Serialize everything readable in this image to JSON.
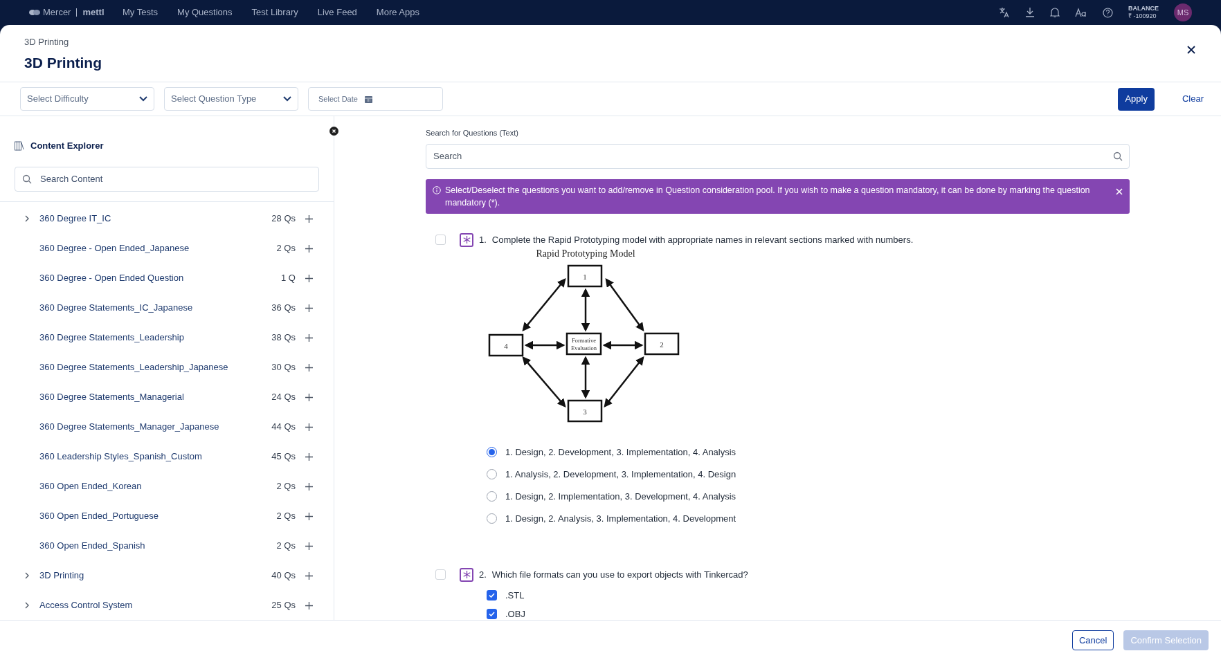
{
  "top_nav": {
    "logo": {
      "brand": "Mercer",
      "product": "mettl"
    },
    "items": [
      "My Tests",
      "My Questions",
      "Test Library",
      "Live Feed",
      "More Apps"
    ],
    "balance_label": "BALANCE",
    "balance_value": "₹ -100920",
    "avatar": "MS"
  },
  "modal": {
    "breadcrumb": "3D Printing",
    "title": "3D Printing"
  },
  "filters": {
    "difficulty": {
      "placeholder": "Select Difficulty"
    },
    "question_type": {
      "placeholder": "Select Question Type"
    },
    "date": {
      "placeholder": "Select Date"
    },
    "apply": "Apply",
    "clear": "Clear"
  },
  "sidebar": {
    "title": "Content Explorer",
    "search": {
      "placeholder": "Search Content"
    },
    "items": [
      {
        "label": "360 Degree IT_IC",
        "count": "28 Qs",
        "kind": "folder"
      },
      {
        "label": "360 Degree - Open Ended_Japanese",
        "count": "2 Qs",
        "kind": "leaf"
      },
      {
        "label": "360 Degree - Open Ended Question",
        "count": "1 Q",
        "kind": "leaf"
      },
      {
        "label": "360 Degree Statements_IC_Japanese",
        "count": "36 Qs",
        "kind": "leaf"
      },
      {
        "label": "360 Degree Statements_Leadership",
        "count": "38 Qs",
        "kind": "leaf"
      },
      {
        "label": "360 Degree Statements_Leadership_Japanese",
        "count": "30 Qs",
        "kind": "leaf"
      },
      {
        "label": "360 Degree Statements_Managerial",
        "count": "24 Qs",
        "kind": "leaf"
      },
      {
        "label": "360 Degree Statements_Manager_Japanese",
        "count": "44 Qs",
        "kind": "leaf"
      },
      {
        "label": "360 Leadership Styles_Spanish_Custom",
        "count": "45 Qs",
        "kind": "leaf"
      },
      {
        "label": "360 Open Ended_Korean",
        "count": "2 Qs",
        "kind": "leaf"
      },
      {
        "label": "360 Open Ended_Portuguese",
        "count": "2 Qs",
        "kind": "leaf"
      },
      {
        "label": "360 Open Ended_Spanish",
        "count": "2 Qs",
        "kind": "leaf"
      },
      {
        "label": "3D Printing",
        "count": "40 Qs",
        "kind": "folder"
      },
      {
        "label": "Access Control System",
        "count": "25 Qs",
        "kind": "folder"
      }
    ]
  },
  "question_search": {
    "label": "Search for Questions (Text)",
    "placeholder": "Search"
  },
  "banner": {
    "text": "Select/Deselect the questions you want to add/remove in Question consideration pool. If you wish to make a question mandatory, it can be done by marking the question mandatory (*)."
  },
  "questions": [
    {
      "number": "1.",
      "text": "Complete the Rapid Prototyping model with appropriate names in relevant sections marked with numbers.",
      "selected": false,
      "mandatory": false,
      "kind": "single",
      "diagram": {
        "title": "Rapid Prototyping Model",
        "boxes": [
          "1",
          "2",
          "3",
          "4"
        ],
        "center": [
          "Formative",
          "Evaluation"
        ]
      },
      "options": [
        {
          "label": "1. Design, 2. Development, 3. Implementation, 4. Analysis",
          "selected": true
        },
        {
          "label": "1. Analysis, 2. Development, 3. Implementation, 4. Design",
          "selected": false
        },
        {
          "label": "1. Design, 2. Implementation, 3. Development, 4. Analysis",
          "selected": false
        },
        {
          "label": "1. Design, 2. Analysis, 3. Implementation, 4. Development",
          "selected": false
        }
      ]
    },
    {
      "number": "2.",
      "text": "Which file formats can you use to export objects with Tinkercad?",
      "selected": false,
      "mandatory": false,
      "kind": "multiple",
      "options": [
        {
          "label": ".STL",
          "selected": true
        },
        {
          "label": ".OBJ",
          "selected": true
        }
      ]
    }
  ],
  "footer": {
    "cancel": "Cancel",
    "confirm": "Confirm Selection",
    "confirm_disabled": true
  }
}
